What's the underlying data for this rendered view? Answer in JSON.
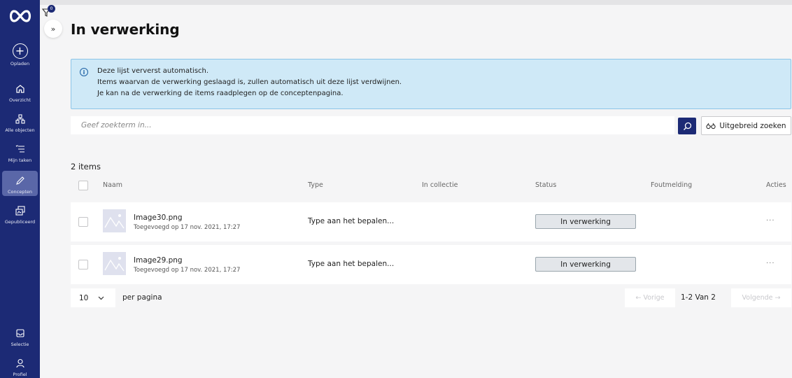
{
  "sidebar": {
    "items": [
      {
        "label": "Opladen",
        "icon": "upload-plus-icon"
      },
      {
        "label": "Overzicht",
        "icon": "home-icon"
      },
      {
        "label": "Alle objecten",
        "icon": "hierarchy-icon"
      },
      {
        "label": "Mijn taken",
        "icon": "task-list-icon"
      },
      {
        "label": "Concepten",
        "icon": "pencil-icon",
        "active": true
      },
      {
        "label": "Gepubliceerd",
        "icon": "published-icon"
      },
      {
        "label": "Selectie",
        "icon": "inbox-icon"
      },
      {
        "label": "Profiel",
        "icon": "user-icon"
      }
    ]
  },
  "filter": {
    "badge": "0"
  },
  "expand": {
    "glyph": "»"
  },
  "page": {
    "title": "In verwerking"
  },
  "info": {
    "lines": [
      "Deze lijst ververst automatisch.",
      "Items waarvan de verwerking geslaagd is, zullen automatisch uit deze lijst verdwijnen.",
      "Je kan na de verwerking de items raadplegen op de conceptenpagina."
    ]
  },
  "search": {
    "placeholder": "Geef zoekterm in...",
    "advanced_label": "Uitgebreid zoeken"
  },
  "list": {
    "count": "2 items",
    "columns": {
      "name": "Naam",
      "type": "Type",
      "collection": "In collectie",
      "status": "Status",
      "error": "Foutmelding",
      "actions": "Acties"
    },
    "rows": [
      {
        "name": "Image30.png",
        "added": "Toegevoegd op 17 nov. 2021, 17:27",
        "type": "Type aan het bepalen...",
        "collection": "",
        "status": "In verwerking",
        "actions": "..."
      },
      {
        "name": "Image29.png",
        "added": "Toegevoegd op 17 nov. 2021, 17:27",
        "type": "Type aan het bepalen...",
        "collection": "",
        "status": "In verwerking",
        "actions": "..."
      }
    ]
  },
  "pagination": {
    "per_page": "10",
    "per_page_label": "per pagina",
    "prev": "← Vorige",
    "info": "1-2 Van 2",
    "next": "Volgende →"
  },
  "colors": {
    "sidebar": "#1c2a75",
    "info_bg": "#cfe9f7",
    "accent": "#1c2a75"
  }
}
